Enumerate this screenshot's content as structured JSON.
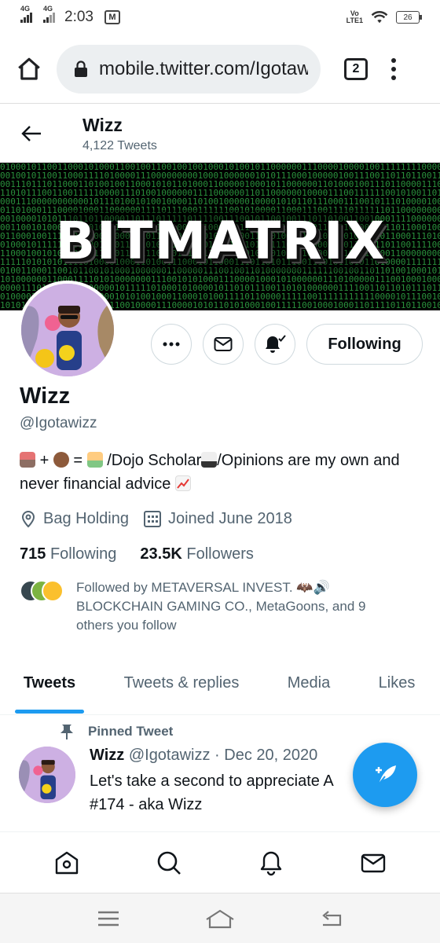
{
  "status_bar": {
    "time": "2:03",
    "net1": "4G",
    "net2": "4G",
    "volte": "Vo\nLTE1",
    "battery": "26"
  },
  "browser": {
    "url": "mobile.twitter.com/Igotawizz",
    "tab_count": "2"
  },
  "profile_header": {
    "name": "Wizz",
    "tweet_count": "4,122 Tweets"
  },
  "banner": {
    "title": "BITMATRIX"
  },
  "actions": {
    "following_label": "Following"
  },
  "profile": {
    "name": "Wizz",
    "handle": "@Igotawizz",
    "bio_part1": "+",
    "bio_part2": "=",
    "bio_part3": "/Dojo Scholar",
    "bio_part4": "/Opinions are my own and never financial advice",
    "location": "Bag Holding",
    "joined": "Joined June 2018",
    "following_count": "715",
    "following_label": "Following",
    "followers_count": "23.5K",
    "followers_label": "Followers",
    "followed_by": "Followed by METAVERSAL INVEST. 🦇🔊 BLOCKCHAIN GAMING CO., MetaGoons, and 9 others you follow"
  },
  "tabs": [
    {
      "label": "Tweets",
      "active": true
    },
    {
      "label": "Tweets & replies"
    },
    {
      "label": "Media"
    },
    {
      "label": "Likes"
    }
  ],
  "pinned_tweet": {
    "pinned_label": "Pinned Tweet",
    "author": "Wizz",
    "handle_date": "@Igotawizz · Dec 20, 2020",
    "text_line1": "Let's take a second to appreciate A",
    "text_line2": "#174 - aka Wizz"
  },
  "colors": {
    "accent": "#1d9bf0",
    "text": "#0f1419",
    "secondary": "#536471"
  },
  "icons": {
    "home": "home-icon",
    "search": "search-icon",
    "bell": "notifications-icon",
    "mail": "messages-icon",
    "compose": "compose-tweet-icon",
    "pin": "pin-icon",
    "location": "location-icon",
    "calendar": "calendar-icon"
  }
}
